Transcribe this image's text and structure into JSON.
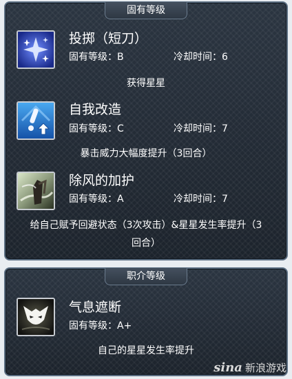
{
  "innate_section": {
    "header": "固有等级",
    "skills": [
      {
        "name": "投掷（短刀）",
        "rank": "固有等级：B",
        "cooldown": "冷却时间：6",
        "effect": "获得星星",
        "icon": "sparkle-dagger-icon"
      },
      {
        "name": "自我改造",
        "rank": "固有等级：C",
        "cooldown": "冷却时间：7",
        "effect": "暴击威力大幅度提升（3回合）",
        "icon": "self-modification-icon"
      },
      {
        "name": "除风的加护",
        "rank": "固有等级：A",
        "cooldown": "冷却时间：7",
        "effect_line1": "给自己赋予回避状态（3次攻击）&星星发生率提升（3",
        "effect_line2": "回合）",
        "icon": "wind-protection-icon"
      }
    ]
  },
  "class_section": {
    "header": "职介等级",
    "skills": [
      {
        "name": "气息遮断",
        "rank": "固有等级：A+",
        "effect": "自己的星星发生率提升",
        "icon": "presence-concealment-icon"
      }
    ]
  },
  "watermark": {
    "logo": "sina",
    "text": "新浪游戏"
  },
  "colors": {
    "panel_bg": "#232c36",
    "panel_border": "#5b6e82",
    "text": "#ffffff"
  }
}
